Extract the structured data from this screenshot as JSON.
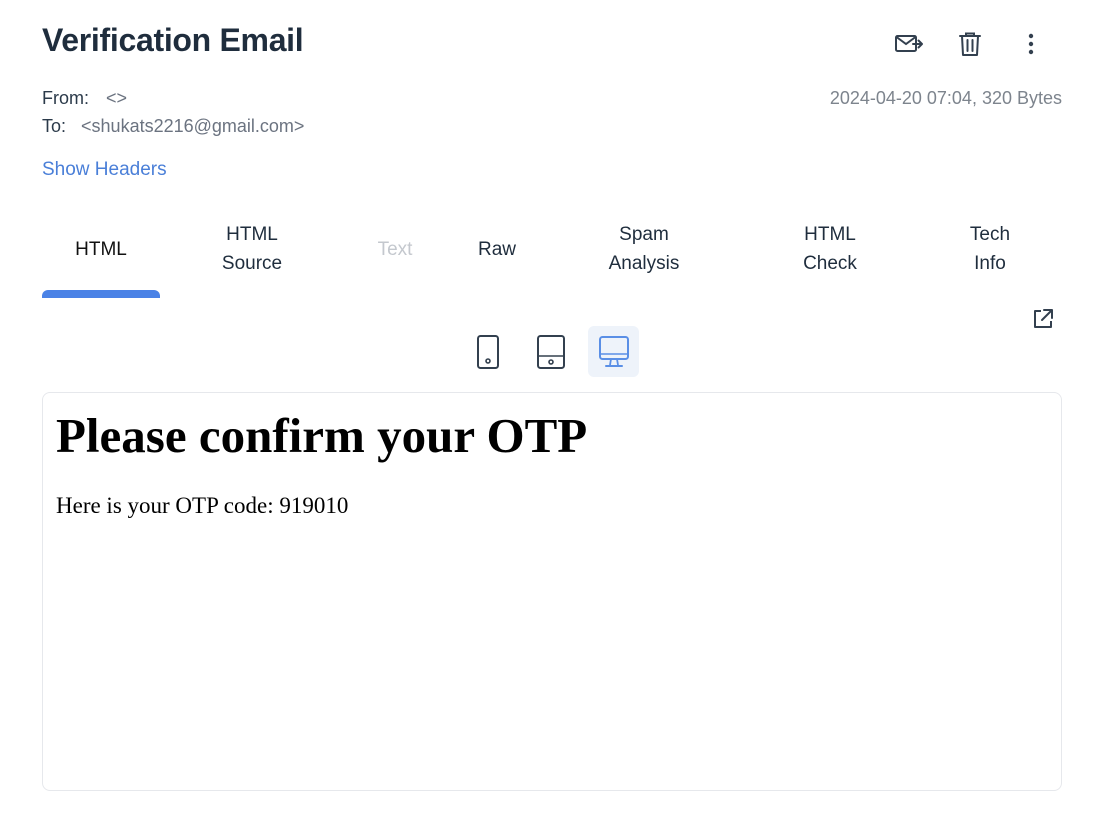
{
  "email": {
    "subject": "Verification Email",
    "from_label": "From:",
    "from_value": "<>",
    "to_label": "To:",
    "to_value": "<shukats2216@gmail.com>",
    "date_size": "2024-04-20 07:04, 320 Bytes",
    "show_headers": "Show Headers"
  },
  "actions": {
    "icons": [
      "forward-mail-icon",
      "trash-icon",
      "more-vertical-icon"
    ]
  },
  "tabs": [
    {
      "label": "HTML",
      "state": "active"
    },
    {
      "label": "HTML\nSource",
      "state": "normal"
    },
    {
      "label": "Text",
      "state": "disabled"
    },
    {
      "label": "Raw",
      "state": "normal"
    },
    {
      "label": "Spam\nAnalysis",
      "state": "normal"
    },
    {
      "label": "HTML\nCheck",
      "state": "normal"
    },
    {
      "label": "Tech\nInfo",
      "state": "normal"
    }
  ],
  "devices": {
    "options": [
      "mobile",
      "tablet",
      "desktop"
    ],
    "selected": "desktop"
  },
  "preview": {
    "heading": "Please confirm your OTP",
    "body": "Here is your OTP code: 919010"
  },
  "colors": {
    "accent": "#4a82e6",
    "link": "#4a7fd8",
    "disabled_tab": "#c4c8ce"
  }
}
